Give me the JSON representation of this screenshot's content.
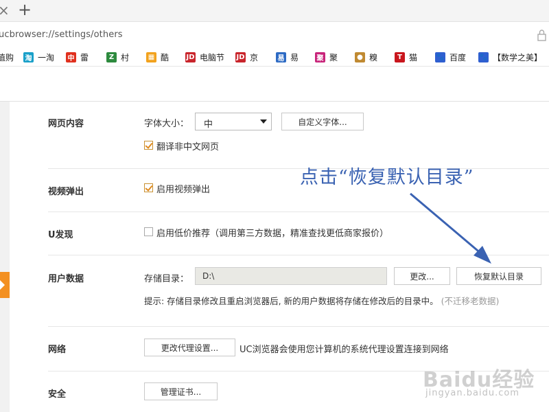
{
  "tabbar": {
    "close_glyph": "×",
    "new_tab_glyph": "+"
  },
  "address": {
    "url": "ucbrowser://settings/others"
  },
  "bookmarks": [
    {
      "label": "值购",
      "icon": "",
      "color": ""
    },
    {
      "label": "一淘",
      "icon": "淘",
      "color": "#1aa0c9"
    },
    {
      "label": "雷",
      "icon": "中",
      "color": "#e0301e"
    },
    {
      "label": "村",
      "icon": "Z",
      "color": "#2d8a3e"
    },
    {
      "label": "酷",
      "icon": "▦",
      "color": "#f2a21d"
    },
    {
      "label": "电脑节",
      "icon": "JD",
      "color": "#c9252c"
    },
    {
      "label": "京",
      "icon": "JD",
      "color": "#c9252c"
    },
    {
      "label": "易",
      "icon": "易",
      "color": "#2e6bc4"
    },
    {
      "label": "聚",
      "icon": "聚",
      "color": "#c8247a"
    },
    {
      "label": "糗",
      "icon": "●",
      "color": "#c08a32"
    },
    {
      "label": "猫",
      "icon": "T",
      "color": "#c9161d"
    },
    {
      "label": "百度",
      "icon": "🐾",
      "color": "#2f5fd0"
    },
    {
      "label": "【数学之美】",
      "icon": "🐾",
      "color": "#2f5fd0"
    }
  ],
  "settings": {
    "web_content": {
      "title": "网页内容",
      "font_size_label": "字体大小：",
      "font_size_value": "中",
      "custom_font_button": "自定义字体...",
      "translate_label": "翻译非中文网页",
      "translate_checked": true
    },
    "video_popup": {
      "title": "视频弹出",
      "enable_label": "启用视频弹出",
      "enable_checked": true
    },
    "u_discover": {
      "title": "U发现",
      "enable_label": "启用低价推荐（调用第三方数据，精准查找更低商家报价）",
      "enable_checked": false
    },
    "user_data": {
      "title": "用户数据",
      "storage_label": "存储目录：",
      "storage_value": "D:\\",
      "change_button": "更改...",
      "restore_button": "恢复默认目录",
      "hint": "提示: 存储目录修改且重启浏览器后, 新的用户数据将存储在修改后的目录中。",
      "hint_note": "(不迁移老数据)"
    },
    "network": {
      "title": "网络",
      "proxy_button": "更改代理设置...",
      "proxy_desc": "UC浏览器会使用您计算机的系统代理设置连接到网络"
    },
    "security": {
      "title": "安全",
      "cert_button": "管理证书..."
    }
  },
  "annotation": {
    "text": "点击“恢复默认目录”",
    "color": "#3a62b2"
  },
  "watermark": {
    "logo": "Baidu经验",
    "url": "jingyan.baidu.com"
  },
  "colors": {
    "accent": "#f39021",
    "annotation": "#3a62b2",
    "check": "#e08a1e"
  }
}
